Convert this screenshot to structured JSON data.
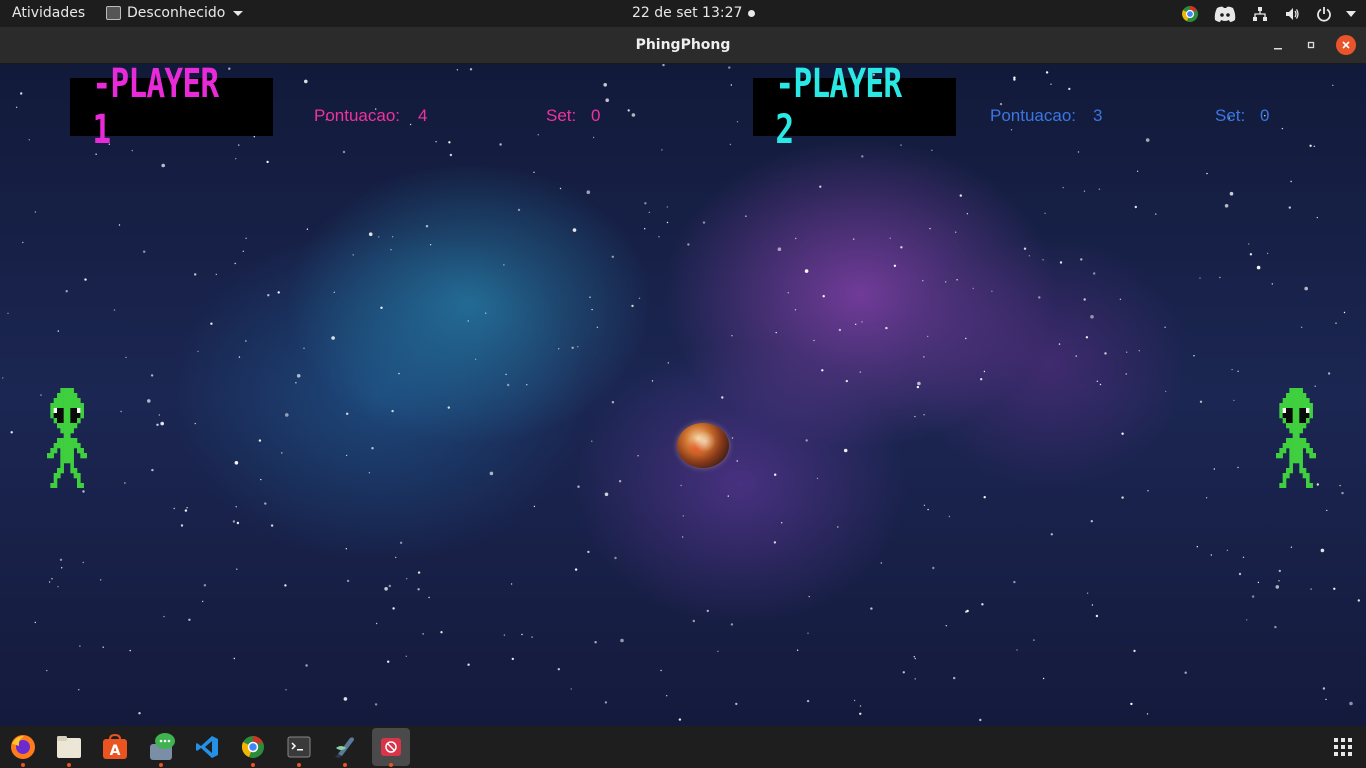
{
  "topbar": {
    "activities": "Atividades",
    "app_name": "Desconhecido",
    "clock": "22 de set  13:27"
  },
  "window": {
    "title": "PhingPhong"
  },
  "game": {
    "player1": {
      "logo": "-PLAYER 1",
      "score_label": "Pontuacao:",
      "score": "4",
      "set_label": "Set:",
      "set": "0",
      "color": "#f0329f"
    },
    "player2": {
      "logo": "-PLAYER 2",
      "score_label": "Pontuacao:",
      "score": "3",
      "set_label": "Set:",
      "set": "0",
      "color": "#3b76e0"
    }
  },
  "dock": {
    "items": [
      {
        "icon": "firefox-icon"
      },
      {
        "icon": "files-icon"
      },
      {
        "icon": "software-center-icon"
      },
      {
        "icon": "chat-icon"
      },
      {
        "icon": "vscode-icon"
      },
      {
        "icon": "chrome-icon"
      },
      {
        "icon": "terminal-icon"
      },
      {
        "icon": "inkscape-icon"
      },
      {
        "icon": "phingphong-app-icon"
      }
    ]
  }
}
